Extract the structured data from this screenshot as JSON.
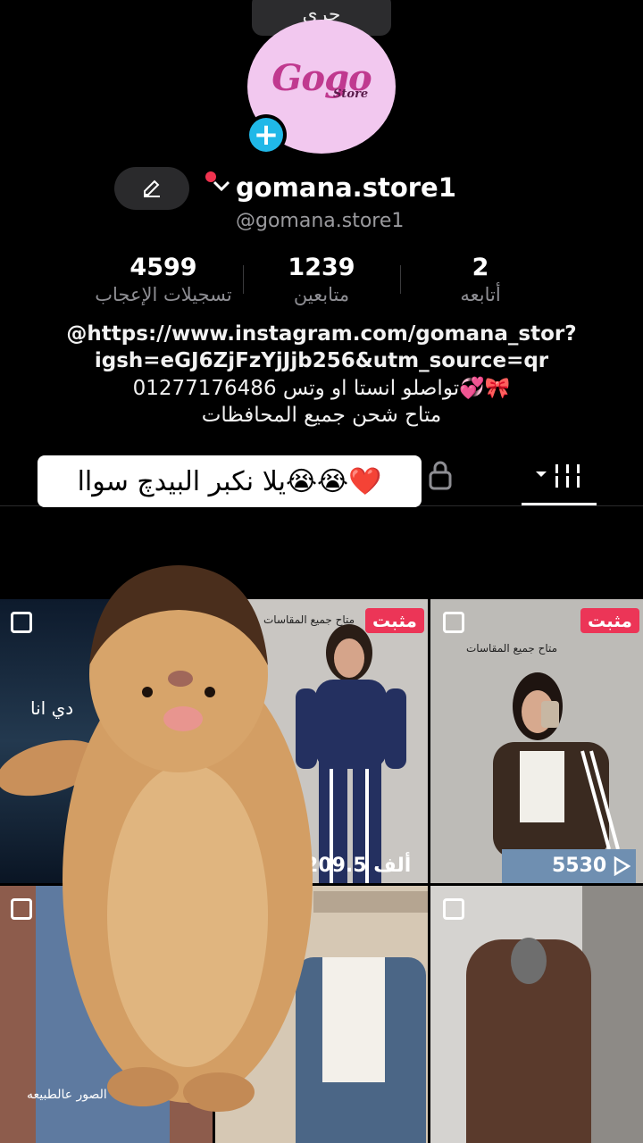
{
  "bubble": {
    "text": "جرى"
  },
  "avatar": {
    "logo_main": "Gogo",
    "logo_sub": "Store"
  },
  "profile": {
    "username": "gomana.store1",
    "handle": "@gomana.store1"
  },
  "stats": [
    {
      "value": "4599",
      "label": "تسجيلات الإعجاب"
    },
    {
      "value": "1239",
      "label": "متابعين"
    },
    {
      "value": "2",
      "label": "أتابعه"
    }
  ],
  "bio": {
    "line1": "@https://www.instagram.com/gomana_stor?",
    "line2": "igsh=eGJ6ZjFzYjJjb256&utm_source=qr",
    "line3": "تواصلو انستا او وتس 01277176486💞🎀",
    "line4": "متاح شحن جميع المحافظات"
  },
  "caption": "يلا نكبر البيدچ سواا😭😭❤️",
  "grid": {
    "pinned_label": "مثبت",
    "cells": [
      {
        "overlay": "دي انا"
      },
      {
        "views": "209.5 ألف",
        "overlay": "متاح جميع المقاسات"
      },
      {
        "views": "5530",
        "overlay": "متاح جميع المقاسات"
      },
      {
        "overlay": "الصور عالطبيعه"
      },
      {
        "overlay": ""
      },
      {
        "overlay": ""
      }
    ]
  },
  "colors": {
    "accent_blue": "#20b8e8",
    "pin_red": "#ec3557",
    "avatar_pink": "#f2c8ef"
  }
}
